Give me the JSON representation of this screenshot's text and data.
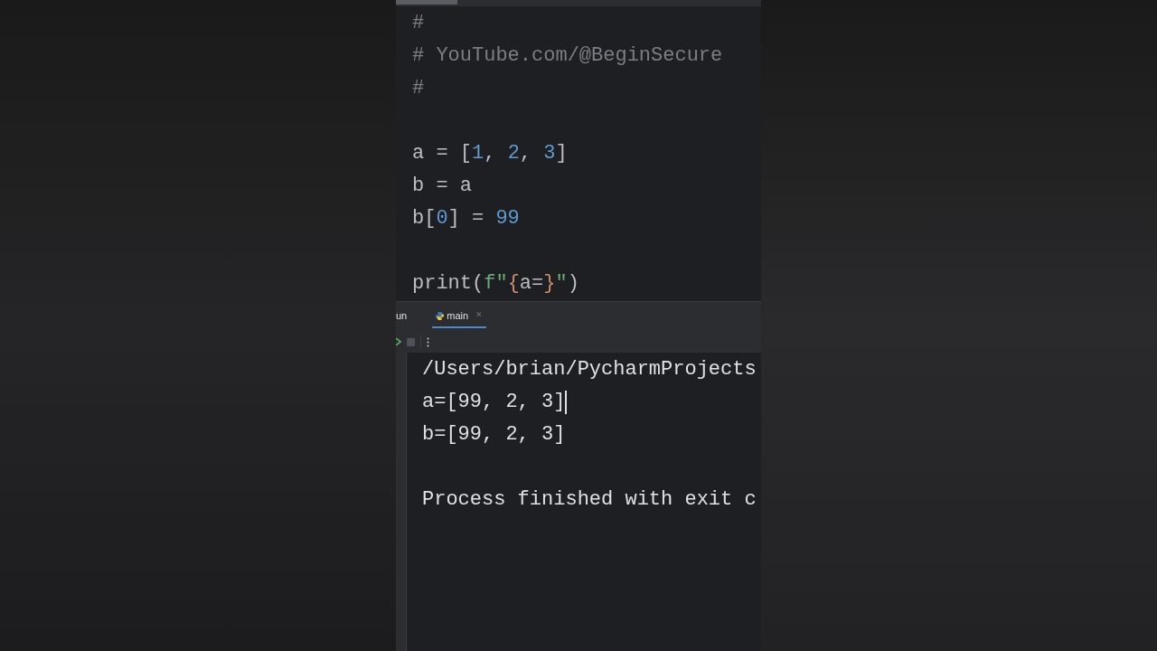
{
  "editor": {
    "lines": [
      {
        "kind": "code",
        "tokens": [
          {
            "kind": "comment",
            "text": "#"
          }
        ]
      },
      {
        "kind": "code",
        "tokens": [
          {
            "kind": "comment",
            "text": "# YouTube.com/@BeginSecure"
          }
        ]
      },
      {
        "kind": "code",
        "tokens": [
          {
            "kind": "comment",
            "text": "#"
          }
        ]
      },
      {
        "kind": "blank"
      },
      {
        "kind": "code",
        "tokens": [
          {
            "kind": "plain",
            "text": "a = ["
          },
          {
            "kind": "number",
            "text": "1"
          },
          {
            "kind": "plain",
            "text": ", "
          },
          {
            "kind": "number",
            "text": "2"
          },
          {
            "kind": "plain",
            "text": ", "
          },
          {
            "kind": "number",
            "text": "3"
          },
          {
            "kind": "plain",
            "text": "]"
          }
        ]
      },
      {
        "kind": "code",
        "tokens": [
          {
            "kind": "plain",
            "text": "b = a"
          }
        ]
      },
      {
        "kind": "code",
        "tokens": [
          {
            "kind": "plain",
            "text": "b["
          },
          {
            "kind": "number",
            "text": "0"
          },
          {
            "kind": "plain",
            "text": "] = "
          },
          {
            "kind": "number",
            "text": "99"
          }
        ]
      },
      {
        "kind": "blank"
      },
      {
        "kind": "code",
        "tokens": [
          {
            "kind": "plain",
            "text": "print("
          },
          {
            "kind": "string",
            "text": "f\""
          },
          {
            "kind": "brace",
            "text": "{"
          },
          {
            "kind": "plain",
            "text": "a="
          },
          {
            "kind": "brace",
            "text": "}"
          },
          {
            "kind": "string",
            "text": "\""
          },
          {
            "kind": "plain",
            "text": ")"
          }
        ]
      }
    ]
  },
  "run_panel": {
    "tabs": [
      {
        "kind": "plain",
        "label": "un",
        "selected": false
      },
      {
        "kind": "python",
        "label": "main",
        "selected": true,
        "close": "✕"
      }
    ],
    "output": [
      {
        "kind": "text",
        "text": "/Users/brian/PycharmProjects",
        "cursor": false
      },
      {
        "kind": "text",
        "text": "a=[99, 2, 3]",
        "cursor": true
      },
      {
        "kind": "text",
        "text": "b=[99, 2, 3]",
        "cursor": false
      },
      {
        "kind": "blank"
      },
      {
        "kind": "text",
        "text": "Process finished with exit c",
        "cursor": false
      }
    ]
  }
}
